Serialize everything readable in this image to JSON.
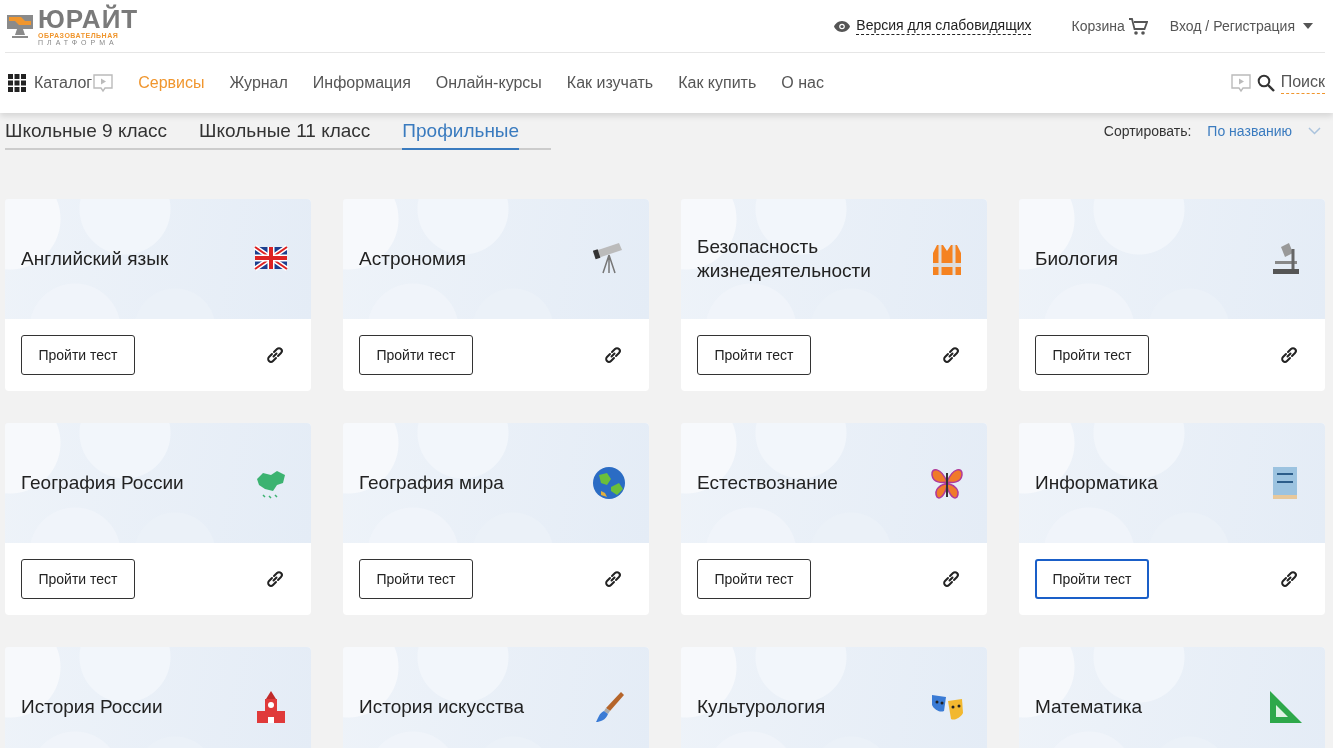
{
  "logo": {
    "name": "ЮРАЙТ",
    "line_1": "ОБРАЗОВАТЕЛЬНАЯ",
    "line_2": "ПЛАТФОРМА"
  },
  "top_bar": {
    "accessibility_link": "Версия для слабовидящих",
    "cart": "Корзина",
    "login": "Вход / Регистрация"
  },
  "nav": {
    "catalog": "Каталог",
    "items": [
      {
        "label": "Сервисы",
        "selected": true
      },
      {
        "label": "Журнал",
        "selected": false
      },
      {
        "label": "Информация",
        "selected": false
      },
      {
        "label": "Онлайн-курсы",
        "selected": false
      },
      {
        "label": "Как изучать",
        "selected": false
      },
      {
        "label": "Как купить",
        "selected": false
      },
      {
        "label": "О нас",
        "selected": false
      }
    ],
    "search": "Поиск"
  },
  "tabs": [
    {
      "label": "Школьные 9 класс",
      "selected": false
    },
    {
      "label": "Школьные 11 класс",
      "selected": false
    },
    {
      "label": "Профильные",
      "selected": true
    }
  ],
  "sort": {
    "label": "Сортировать:",
    "value": "По названию"
  },
  "cards": [
    {
      "title": "Английский язык",
      "button": "Пройти тест",
      "focused": false
    },
    {
      "title": "Астрономия",
      "button": "Пройти тест",
      "focused": false
    },
    {
      "title": "Безопасность жизнедеятельности",
      "button": "Пройти тест",
      "focused": false
    },
    {
      "title": "Биология",
      "button": "Пройти тест",
      "focused": false
    },
    {
      "title": "География России",
      "button": "Пройти тест",
      "focused": false
    },
    {
      "title": "География мира",
      "button": "Пройти тест",
      "focused": false
    },
    {
      "title": "Естествознание",
      "button": "Пройти тест",
      "focused": false
    },
    {
      "title": "Информатика",
      "button": "Пройти тест",
      "focused": true
    },
    {
      "title": "История России"
    },
    {
      "title": "История искусства"
    },
    {
      "title": "Культурология"
    },
    {
      "title": "Математика"
    }
  ]
}
